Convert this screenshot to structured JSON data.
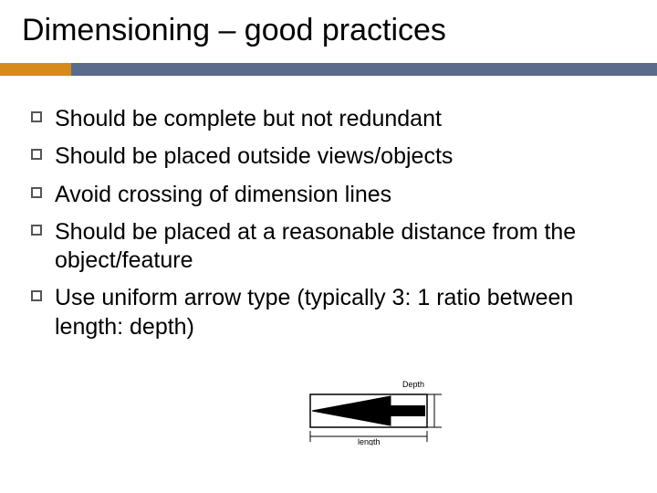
{
  "title": "Dimensioning – good practices",
  "bullets": [
    "Should be complete but not redundant",
    "Should be placed outside views/objects",
    "Avoid crossing of dimension lines",
    "Should be placed at a reasonable distance from the object/feature",
    "Use uniform arrow type (typically 3: 1 ratio between length: depth)"
  ],
  "diagram": {
    "label_top": "Depth",
    "label_bottom": "length"
  }
}
